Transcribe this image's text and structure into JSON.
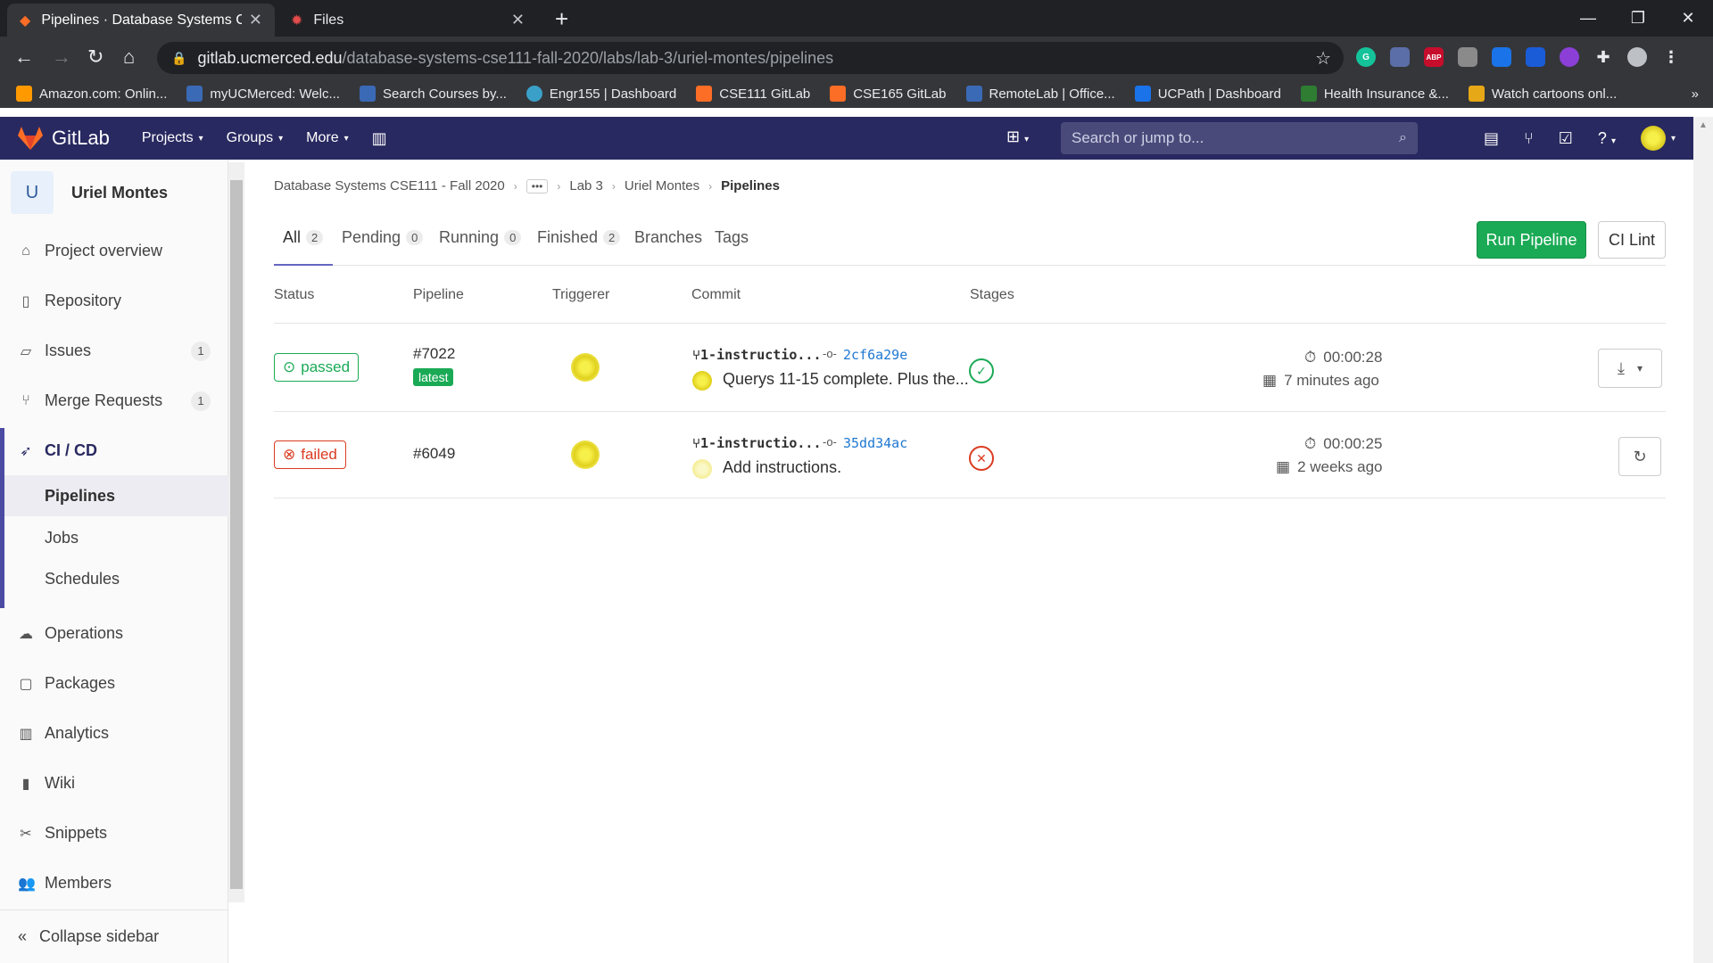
{
  "browser": {
    "tabs": [
      {
        "label": "Pipelines · Database Systems CSE",
        "active": true
      },
      {
        "label": "Files",
        "active": false
      }
    ],
    "url_host": "gitlab.ucmerced.edu",
    "url_path": "/database-systems-cse111-fall-2020/labs/lab-3/uriel-montes/pipelines",
    "bookmarks": [
      "Amazon.com: Onlin...",
      "myUCMerced: Welc...",
      "Search Courses by...",
      "Engr155 | Dashboard",
      "CSE111 GitLab",
      "CSE165 GitLab",
      "RemoteLab | Office...",
      "UCPath | Dashboard",
      "Health Insurance &...",
      "Watch cartoons onl..."
    ],
    "extensions": [
      "G",
      "",
      "ABP",
      "",
      "",
      "",
      "",
      ""
    ]
  },
  "gitlab": {
    "brand": "GitLab",
    "nav": [
      "Projects",
      "Groups",
      "More"
    ],
    "search_placeholder": "Search or jump to..."
  },
  "sidebar": {
    "project_initial": "U",
    "project_name": "Uriel Montes",
    "items": [
      {
        "label": "Project overview",
        "icon": "home-icon"
      },
      {
        "label": "Repository",
        "icon": "doc-icon"
      },
      {
        "label": "Issues",
        "icon": "issues-icon",
        "count": "1"
      },
      {
        "label": "Merge Requests",
        "icon": "merge-icon",
        "count": "1"
      },
      {
        "label": "CI / CD",
        "icon": "rocket-icon"
      },
      {
        "label": "Operations",
        "icon": "cloud-icon"
      },
      {
        "label": "Packages",
        "icon": "package-icon"
      },
      {
        "label": "Analytics",
        "icon": "chart-icon"
      },
      {
        "label": "Wiki",
        "icon": "book-icon"
      },
      {
        "label": "Snippets",
        "icon": "scissors-icon"
      },
      {
        "label": "Members",
        "icon": "users-icon"
      }
    ],
    "cicd_sub": [
      "Pipelines",
      "Jobs",
      "Schedules"
    ],
    "collapse_label": "Collapse sidebar"
  },
  "breadcrumb": [
    "Database Systems CSE111 - Fall 2020",
    "Lab 3",
    "Uriel Montes",
    "Pipelines"
  ],
  "tabs": [
    {
      "label": "All",
      "count": "2"
    },
    {
      "label": "Pending",
      "count": "0"
    },
    {
      "label": "Running",
      "count": "0"
    },
    {
      "label": "Finished",
      "count": "2"
    },
    {
      "label": "Branches",
      "count": null
    },
    {
      "label": "Tags",
      "count": null
    }
  ],
  "buttons": {
    "run_pipeline": "Run Pipeline",
    "ci_lint": "CI Lint"
  },
  "table": {
    "headers": [
      "Status",
      "Pipeline",
      "Triggerer",
      "Commit",
      "Stages"
    ],
    "rows": [
      {
        "status": "passed",
        "id": "#7022",
        "tag": "latest",
        "branch": "1-instructio...",
        "sha": "2cf6a29e",
        "message": "Querys 11-15 complete. Plus the...",
        "duration": "00:00:28",
        "finished": "7 minutes ago"
      },
      {
        "status": "failed",
        "id": "#6049",
        "tag": "",
        "branch": "1-instructio...",
        "sha": "35dd34ac",
        "message": "Add instructions.",
        "duration": "00:00:25",
        "finished": "2 weeks ago"
      }
    ]
  },
  "colors": {
    "success": "#1aaa55",
    "danger": "#db3b21",
    "header": "#292961",
    "link": "#1f78d1"
  }
}
